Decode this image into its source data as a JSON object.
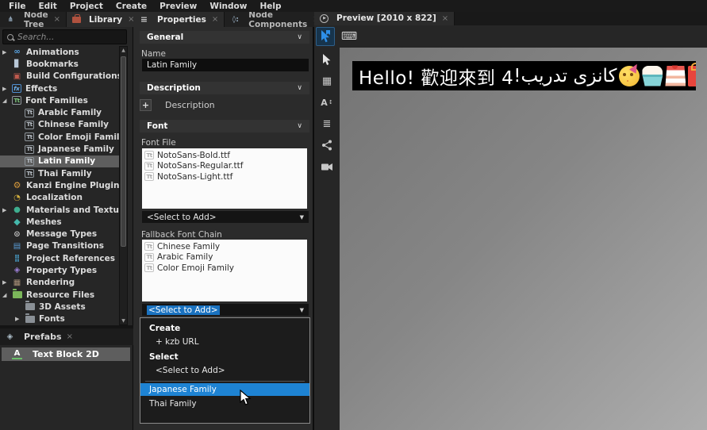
{
  "menu": {
    "items": [
      "File",
      "Edit",
      "Project",
      "Create",
      "Preview",
      "Window",
      "Help"
    ]
  },
  "left": {
    "tabs": {
      "node_tree": "Node Tree",
      "library": "Library"
    },
    "search_placeholder": "Search...",
    "tree": [
      "Animations",
      "Bookmarks",
      "Build Configurations",
      "Effects",
      "Font Families",
      "Arabic Family",
      "Chinese Family",
      "Color Emoji Family",
      "Japanese Family",
      "Latin Family",
      "Thai Family",
      "Kanzi Engine Plugins",
      "Localization",
      "Materials and Textures",
      "Meshes",
      "Message Types",
      "Page Transitions",
      "Project References",
      "Property Types",
      "Rendering",
      "Resource Files",
      "3D Assets",
      "Fonts"
    ],
    "selected_item": "Latin Family",
    "prefabs": {
      "tab_label": "Prefabs",
      "item": "Text Block 2D"
    }
  },
  "properties": {
    "tab_properties": "Properties",
    "tab_node_components": "Node Components",
    "general_header": "General",
    "name_label": "Name",
    "name_value": "Latin Family",
    "description_header": "Description",
    "description_add": "Description",
    "font_header": "Font",
    "font_file_label": "Font File",
    "font_files": [
      "NotoSans-Bold.ttf",
      "NotoSans-Regular.ttf",
      "NotoSans-Light.ttf"
    ],
    "font_file_select": "<Select to Add>",
    "fallback_label": "Fallback Font Chain",
    "fallback_items": [
      "Chinese Family",
      "Arabic Family",
      "Color Emoji Family"
    ],
    "fallback_select": "<Select to Add>",
    "dropdown": {
      "create_header": "Create",
      "kzb_url": "+ kzb URL",
      "select_header": "Select",
      "select_to_add": "<Select to Add>",
      "option_japanese": "Japanese Family",
      "option_thai": "Thai Family"
    }
  },
  "preview": {
    "tab_label": "Preview [2010 x 822]",
    "text_latin": "Hello! 歡迎來到 4 ",
    "text_arabic": "كانزى تدريب!",
    "emojis": [
      "partying-face",
      "cupcake",
      "shortcake",
      "wrapped-gift"
    ]
  },
  "colors": {
    "accent_blue": "#1e83d3",
    "selection_gray": "#5e5e5e",
    "list_bg": "#ffffff"
  }
}
